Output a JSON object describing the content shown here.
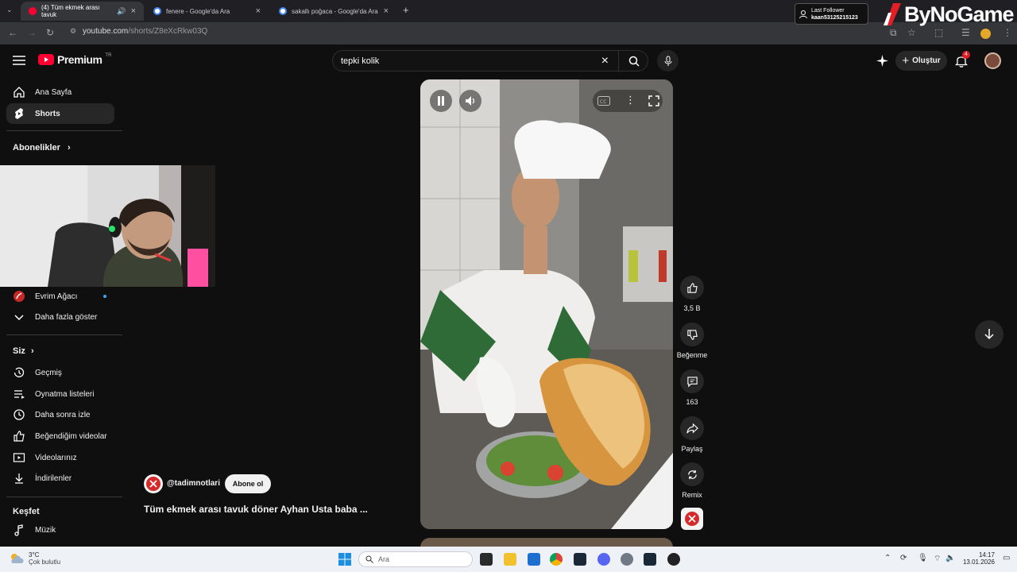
{
  "browser": {
    "tabs": [
      {
        "title": "(4) Tüm ekmek arası tavuk",
        "active": true,
        "favicon": "youtube-favicon",
        "color": "#ff0033"
      },
      {
        "title": "fenere - Google'da Ara",
        "active": false,
        "favicon": "google-favicon",
        "color": "#4285f4"
      },
      {
        "title": "sakallı poğaca - Google'da Ara",
        "active": false,
        "favicon": "google-favicon",
        "color": "#4285f4"
      }
    ],
    "new_tab_symbol": "+",
    "url_host": "youtube.com",
    "url_path": "/shorts/Z8eXcRkw03Q"
  },
  "overlay": {
    "last_follower_label": "Last Follower",
    "last_follower_name": "kaan53125215123",
    "brand": "ByNoGame"
  },
  "header": {
    "logo_text": "Premium",
    "logo_region": "TR",
    "search_value": "tepki kolik",
    "create_label": "Oluştur",
    "notification_count": "4"
  },
  "sidebar": {
    "home": "Ana Sayfa",
    "shorts": "Shorts",
    "subscriptions_heading": "Abonelikler",
    "subscription_channel": "Evrim Ağacı",
    "show_more": "Daha fazla göster",
    "you_heading": "Siz",
    "history": "Geçmiş",
    "playlists": "Oynatma listeleri",
    "watch_later": "Daha sonra izle",
    "liked": "Beğendiğim videolar",
    "your_videos": "Videolarınız",
    "downloads": "İndirilenler",
    "explore_heading": "Keşfet",
    "music": "Müzik"
  },
  "short": {
    "channel": "@tadimnotlari",
    "subscribe": "Abone ol",
    "title": "Tüm ekmek arası tavuk döner Ayhan Usta baba ...",
    "likes": "3,5 B",
    "dislike_label": "Beğenme",
    "comments": "163",
    "share_label": "Paylaş",
    "remix_label": "Remix"
  },
  "taskbar": {
    "weather_temp": "3°C",
    "weather_desc": "Çok bulutlu",
    "search_placeholder": "Ara",
    "time": "14:17",
    "date": "13.01.2026"
  },
  "colors": {
    "accent": "#ff0033",
    "background": "#0f0f0f",
    "chip": "#272727"
  }
}
